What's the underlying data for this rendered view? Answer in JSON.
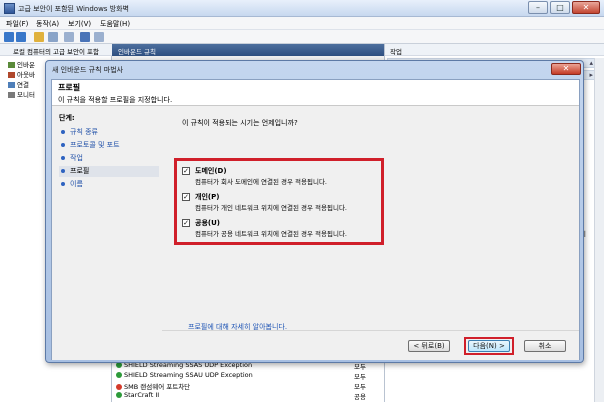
{
  "background_window": {
    "title": "고급 보안이 포함된 Windows 방화벽",
    "menu": [
      "파일(F)",
      "동작(A)",
      "보기(V)",
      "도움말(H)"
    ],
    "tree": {
      "root": "로컬 컴퓨터의 고급 보안이 포함",
      "items": [
        "인바운",
        "아웃바",
        "연결 ",
        "모니터"
      ]
    },
    "center_header": "인바운드 규칙",
    "actions_header": "작업",
    "side_text": "지",
    "rules": [
      {
        "name": "SHIELD Streaming SSAS UDP Exception",
        "profile": "모두",
        "status": "ok"
      },
      {
        "name": "SHIELD Streaming SSAU UDP Exception",
        "profile": "모두",
        "status": "ok"
      },
      {
        "name": "SMB 랜섬웨어 포트차단",
        "profile": "모두",
        "status": "blocked"
      },
      {
        "name": "StarCraft II",
        "profile": "공용",
        "status": "ok"
      }
    ]
  },
  "wizard": {
    "title": "새 인바운드 규칙 마법사",
    "close_label": "✕",
    "heading": "프로필",
    "subheading": "이 규칙을 적용할 프로필을 지정합니다.",
    "steps_label": "단계:",
    "steps": [
      "규칙 종류",
      "프로토콜 및 포트",
      "작업",
      "프로필",
      "이름"
    ],
    "current_step": 3,
    "question": "이 규칙이 적용되는 시기는 언제입니까?",
    "options": [
      {
        "label": "도메인(D)",
        "desc": "컴퓨터가 회사 도메인에 연결된 경우 적용됩니다.",
        "checked": true
      },
      {
        "label": "개인(P)",
        "desc": "컴퓨터가 개인 네트워크 위치에 연결된 경우 적용됩니다.",
        "checked": true
      },
      {
        "label": "공용(U)",
        "desc": "컴퓨터가 공용 네트워크 위치에 연결된 경우 적용됩니다.",
        "checked": true
      }
    ],
    "checkmark": "✓",
    "learn_more": "프로필에 대해 자세히 알아봅니다.",
    "buttons": {
      "back": "< 뒤로(B)",
      "next": "다음(N) >",
      "cancel": "취소"
    }
  },
  "colors": {
    "highlight": "#d01f2a",
    "link": "#1f55b5",
    "header_blue": "#2e4f80"
  }
}
